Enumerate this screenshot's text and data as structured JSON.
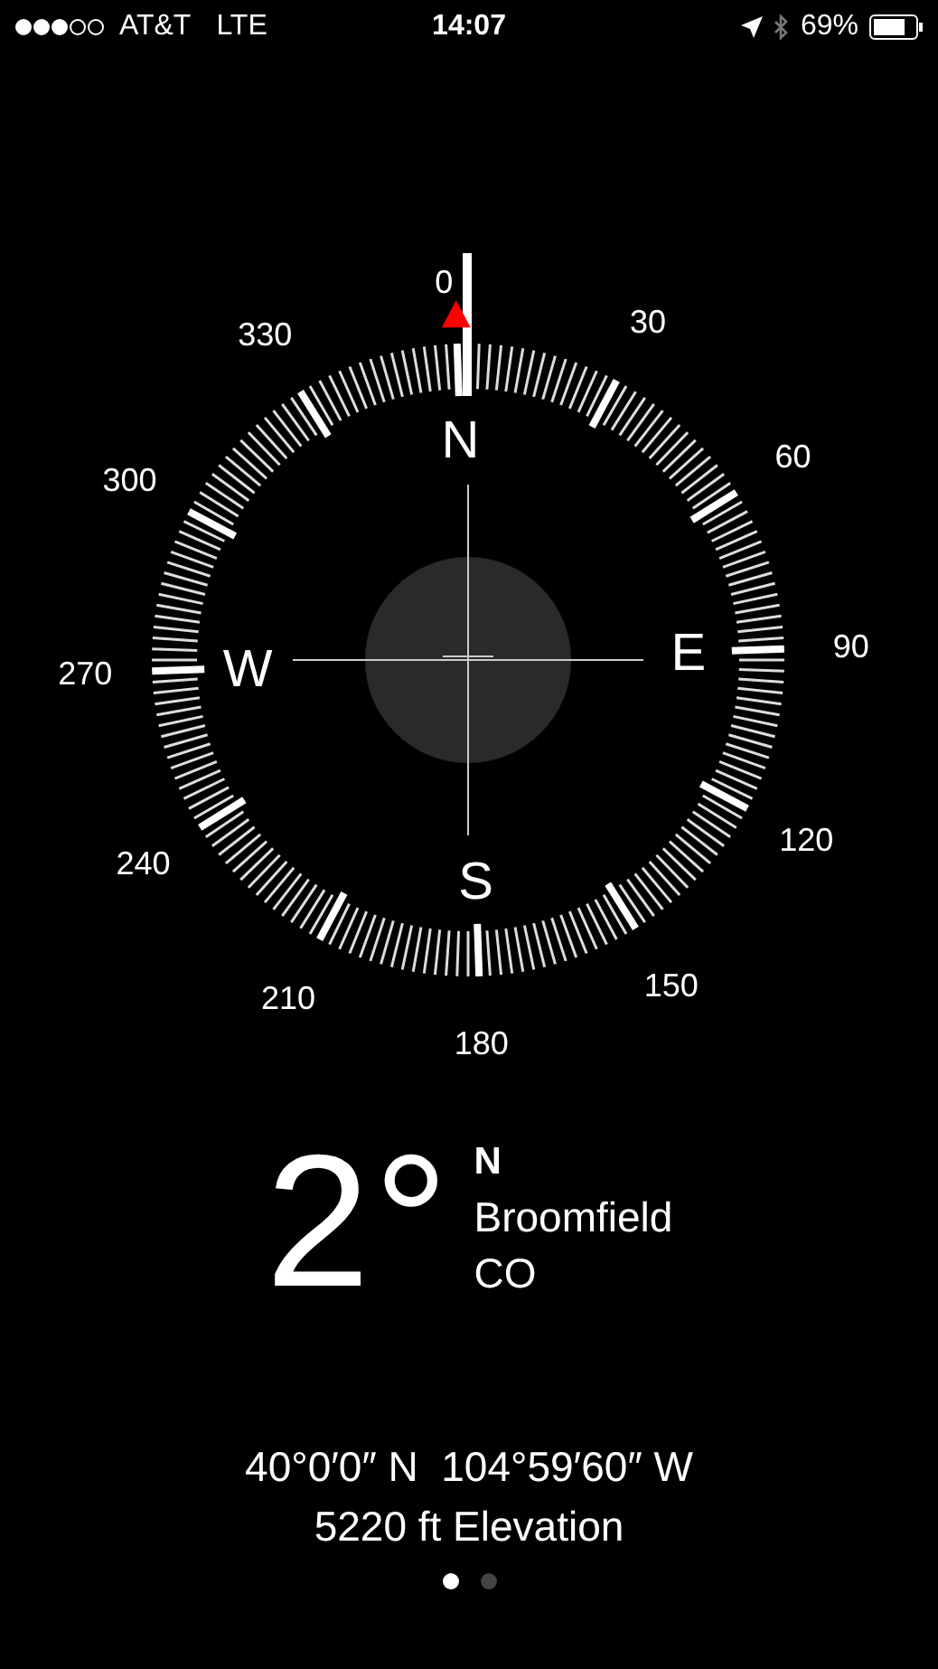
{
  "status_bar": {
    "carrier": "AT&T",
    "network": "LTE",
    "time": "14:07",
    "battery": "69%"
  },
  "compass": {
    "degree_labels": [
      "0",
      "30",
      "60",
      "90",
      "120",
      "150",
      "180",
      "210",
      "240",
      "270",
      "300",
      "330"
    ],
    "cardinals": [
      "N",
      "E",
      "S",
      "W"
    ]
  },
  "reading": {
    "degrees": "2°",
    "direction": "N",
    "place": "Broomfield",
    "region": "CO"
  },
  "coordinates": "40°0′0″ N  104°59′60″ W",
  "elevation": "5220 ft Elevation",
  "pages": [
    {
      "selected": true
    },
    {
      "selected": false
    }
  ]
}
